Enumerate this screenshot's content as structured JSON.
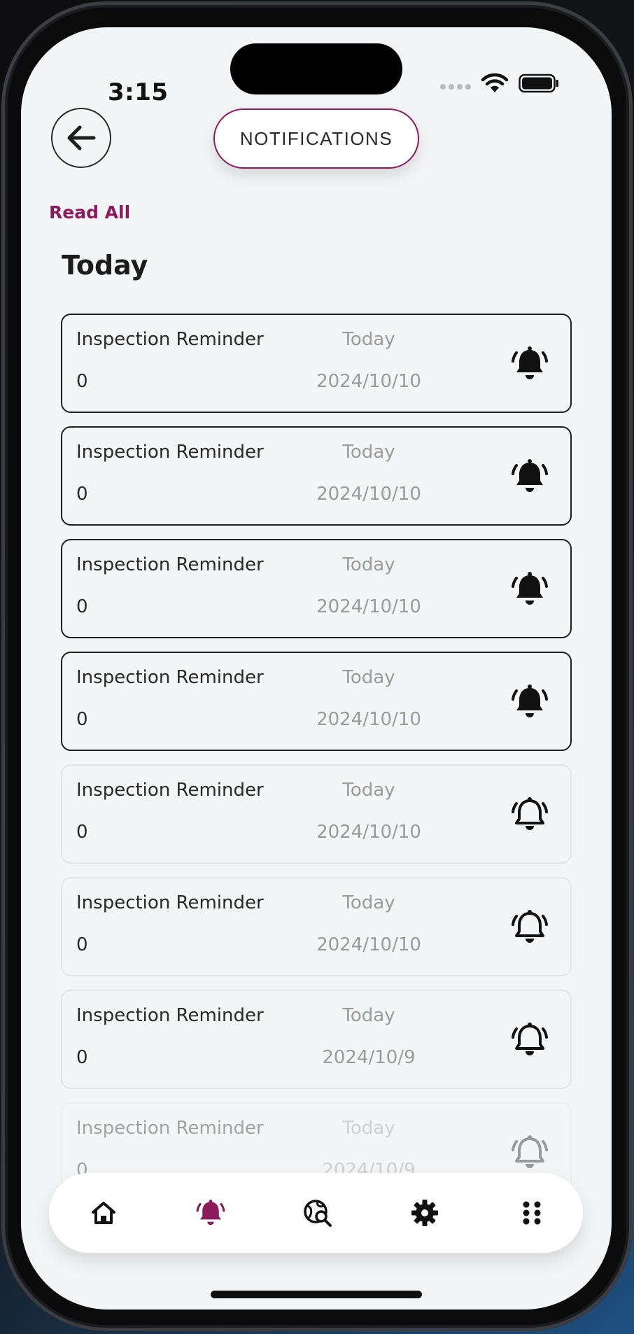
{
  "status_bar": {
    "time": "3:15"
  },
  "header": {
    "back_icon": "arrow-left-icon",
    "title": "NOTIFICATIONS"
  },
  "actions": {
    "read_all_label": "Read All"
  },
  "section": {
    "title": "Today"
  },
  "notifications": [
    {
      "title": "Inspection Reminder",
      "count": "0",
      "day": "Today",
      "date": "2024/10/10",
      "state": "unread"
    },
    {
      "title": "Inspection Reminder",
      "count": "0",
      "day": "Today",
      "date": "2024/10/10",
      "state": "unread"
    },
    {
      "title": "Inspection Reminder",
      "count": "0",
      "day": "Today",
      "date": "2024/10/10",
      "state": "unread"
    },
    {
      "title": "Inspection Reminder",
      "count": "0",
      "day": "Today",
      "date": "2024/10/10",
      "state": "unread"
    },
    {
      "title": "Inspection Reminder",
      "count": "0",
      "day": "Today",
      "date": "2024/10/10",
      "state": "read"
    },
    {
      "title": "Inspection Reminder",
      "count": "0",
      "day": "Today",
      "date": "2024/10/10",
      "state": "read"
    },
    {
      "title": "Inspection Reminder",
      "count": "0",
      "day": "Today",
      "date": "2024/10/9",
      "state": "read"
    },
    {
      "title": "Inspection Reminder",
      "count": "0",
      "day": "Today",
      "date": "2024/10/9",
      "state": "read"
    }
  ],
  "tab_bar": {
    "items": [
      {
        "icon": "home-icon",
        "active": false
      },
      {
        "icon": "bell-icon",
        "active": true
      },
      {
        "icon": "globe-search-icon",
        "active": false
      },
      {
        "icon": "gear-icon",
        "active": false
      },
      {
        "icon": "grid-dots-icon",
        "active": false
      }
    ]
  },
  "colors": {
    "accent": "#8c1b5c",
    "background": "#f4f5f7",
    "text": "#2a2a2a",
    "muted": "#9b9b9b"
  }
}
